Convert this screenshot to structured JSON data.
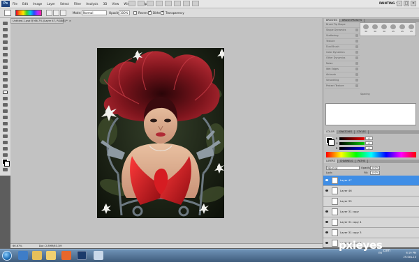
{
  "app": {
    "logo": "Ps",
    "menu": [
      "File",
      "Edit",
      "Image",
      "Layer",
      "Select",
      "Filter",
      "Analysis",
      "3D",
      "View",
      "Window",
      "Help"
    ],
    "workspace": "PAINTING",
    "workspace_arrow": "▼",
    "window_buttons": [
      "–",
      "□",
      "×"
    ]
  },
  "options": {
    "mode_label": "Mode:",
    "mode_value": "Normal",
    "opacity_label": "Opacity:",
    "opacity_value": "100%",
    "reverse_label": "Reverse",
    "reverse_checked": false,
    "dither_label": "Dither",
    "dither_checked": true,
    "transparency_label": "Transparency",
    "transparency_checked": true
  },
  "document": {
    "tab_title": "Untitled-1.psd @ 66.7% (Layer 47, RGB/8) *",
    "tab_close": "×",
    "zoom": "66.67%",
    "doc_size": "Doc: 2.89M/63.3M"
  },
  "brushes_panel": {
    "tabs": [
      "BRUSHES",
      "BRUSH PRESETS"
    ],
    "options": [
      "Brush Tip Shape",
      "Shape Dynamics",
      "Scattering",
      "Texture",
      "Dual Brush",
      "Color Dynamics",
      "Other Dynamics",
      "Noise",
      "Wet Edges",
      "Airbrush",
      "Smoothing",
      "Protect Texture"
    ],
    "tip_sizes": [
      "30",
      "30",
      "30",
      "25",
      "25",
      "25"
    ],
    "spacing_label": "Spacing"
  },
  "color_panel": {
    "tabs": [
      "COLOR",
      "SWATCHES",
      "STYLES"
    ],
    "r": "0",
    "g": "0",
    "b": "0"
  },
  "layers_panel": {
    "tabs": [
      "LAYERS",
      "CHANNELS",
      "PATHS"
    ],
    "blend_mode": "Normal",
    "opacity_label": "Opacity:",
    "opacity": "100%",
    "lock_label": "Lock:",
    "fill_label": "Fill:",
    "fill": "100%",
    "layers": [
      {
        "name": "Layer 47",
        "selected": true,
        "visible": true
      },
      {
        "name": "Layer 46",
        "selected": false,
        "visible": true
      },
      {
        "name": "Layer 35",
        "selected": false,
        "visible": false
      },
      {
        "name": "Layer 31 copy",
        "selected": false,
        "visible": true
      },
      {
        "name": "Layer 31 copy 4",
        "selected": false,
        "visible": true
      },
      {
        "name": "Layer 31 copy 3",
        "selected": false,
        "visible": true
      },
      {
        "name": "Layer 31 copy 5",
        "selected": false,
        "visible": true
      }
    ]
  },
  "taskbar": {
    "language": "EN",
    "time": "6:19 PM",
    "date": "29-Sep-10"
  },
  "watermark": {
    "text": "pxleyes",
    "suffix": ".com"
  },
  "colors": {
    "accent_selected": "#3f8ee6",
    "hair": "#8a1a22",
    "gloves": "#d01820"
  }
}
